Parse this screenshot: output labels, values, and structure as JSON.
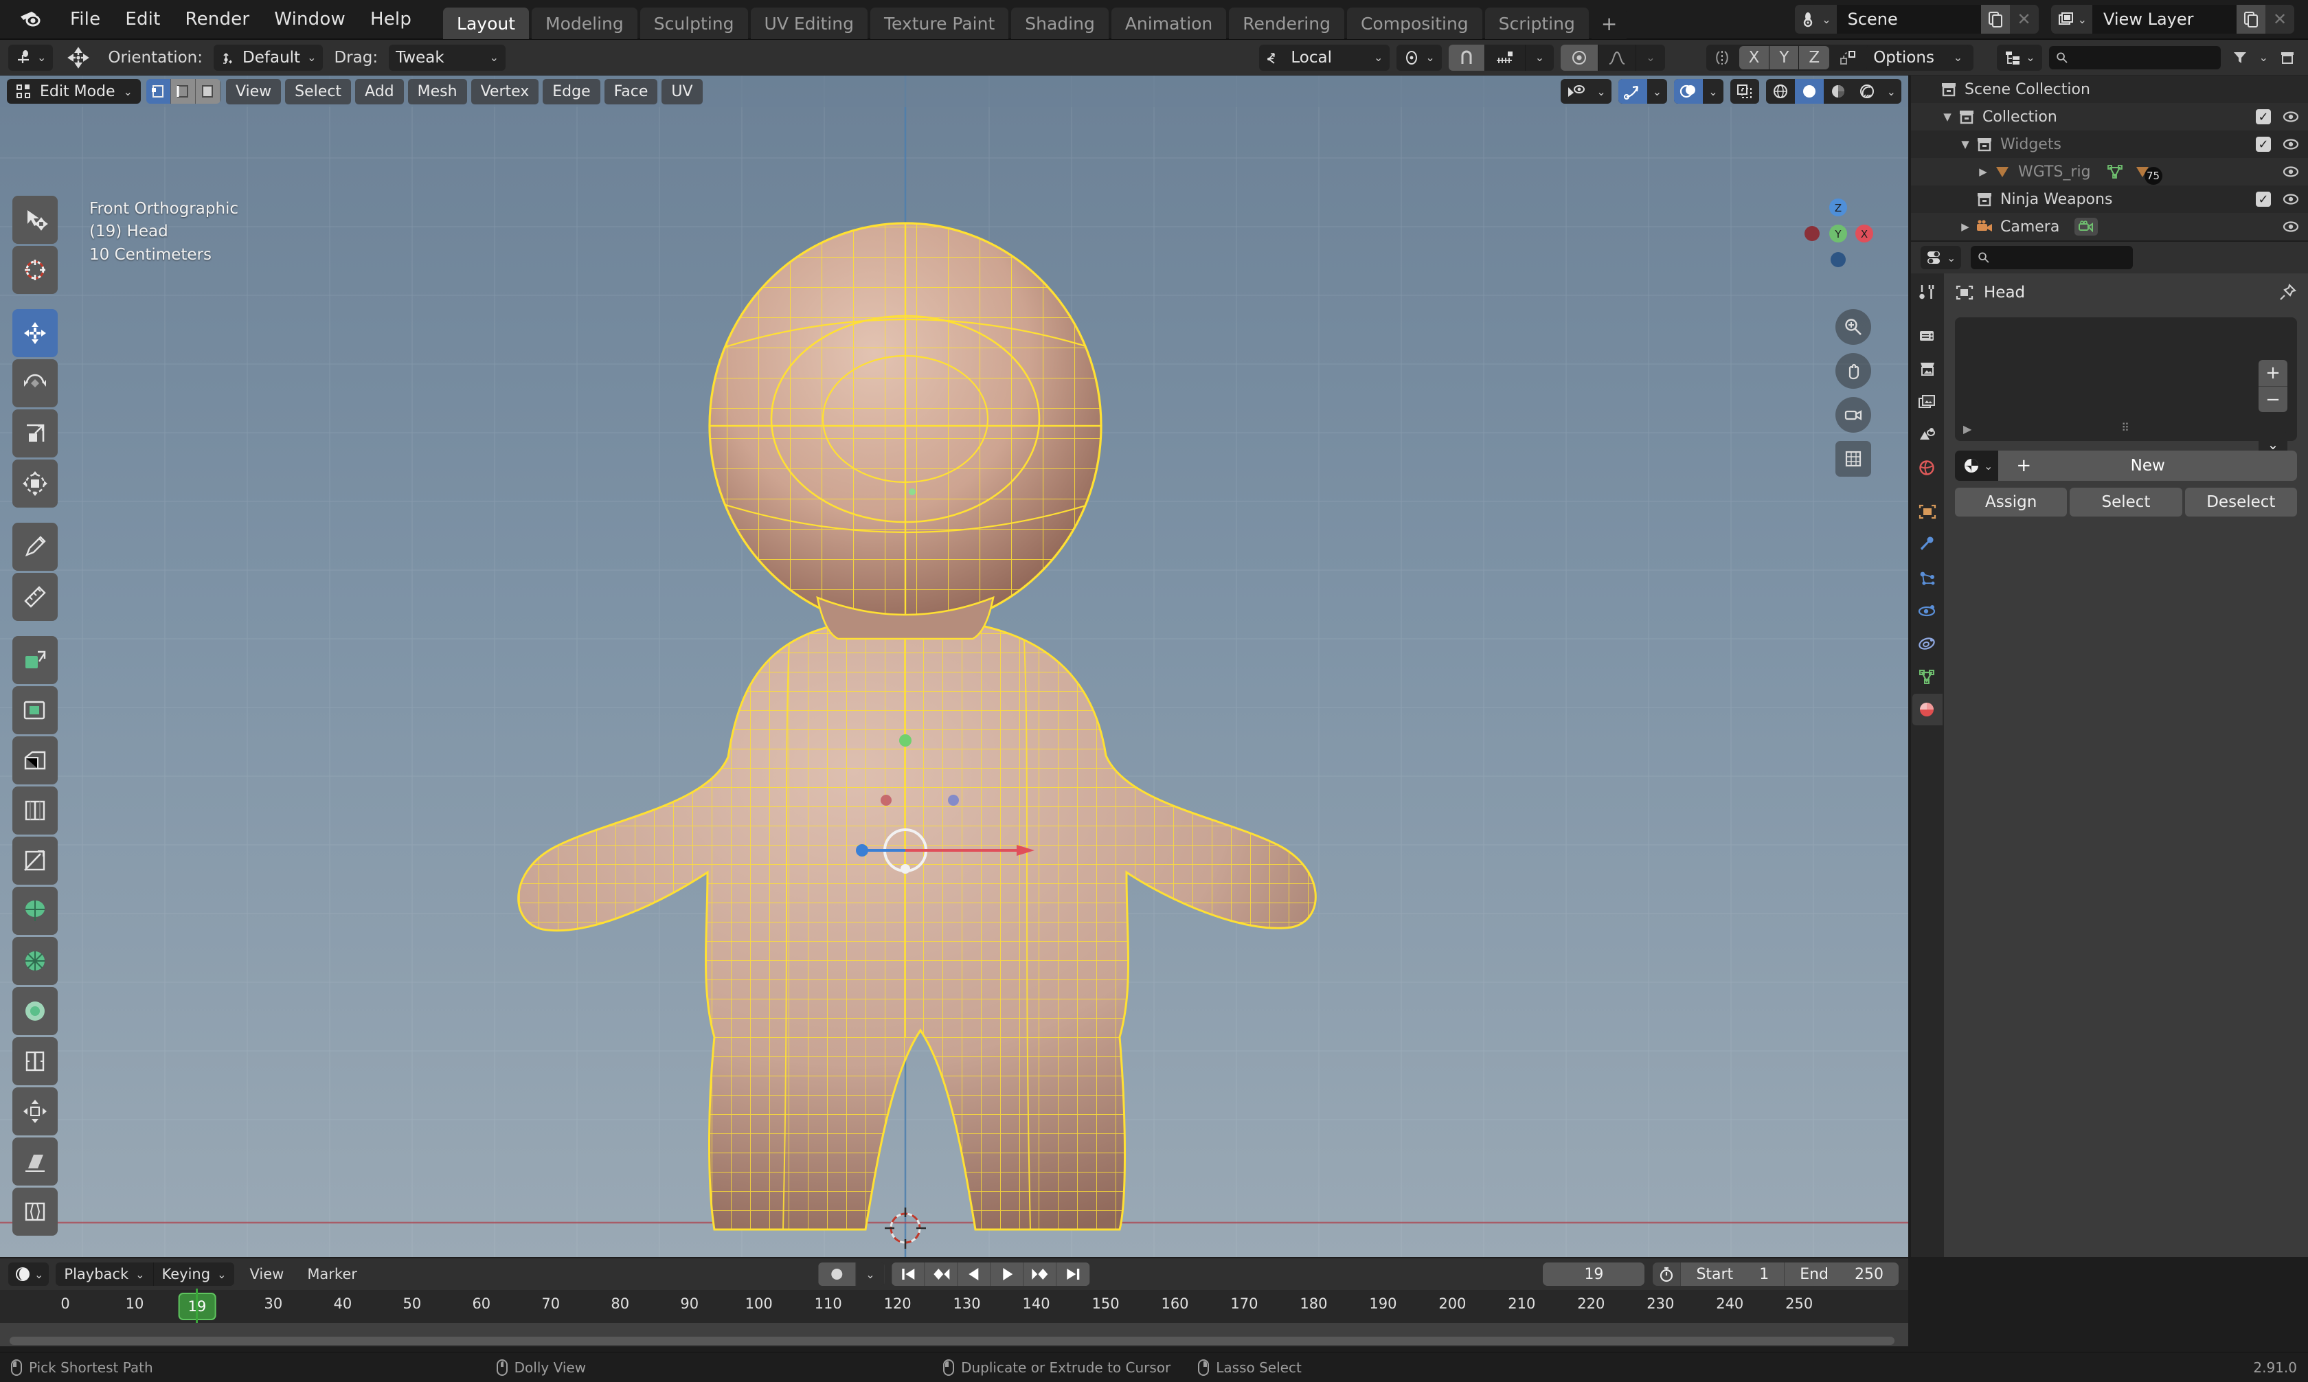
{
  "app": {
    "name": "Blender",
    "version": "2.91.0"
  },
  "topbar": {
    "menus": [
      "File",
      "Edit",
      "Render",
      "Window",
      "Help"
    ],
    "workspaces": [
      {
        "label": "Layout",
        "active": true
      },
      {
        "label": "Modeling",
        "active": false
      },
      {
        "label": "Sculpting",
        "active": false
      },
      {
        "label": "UV Editing",
        "active": false
      },
      {
        "label": "Texture Paint",
        "active": false
      },
      {
        "label": "Shading",
        "active": false
      },
      {
        "label": "Animation",
        "active": false
      },
      {
        "label": "Rendering",
        "active": false
      },
      {
        "label": "Compositing",
        "active": false
      },
      {
        "label": "Scripting",
        "active": false
      }
    ],
    "add_workspace_label": "+",
    "scene": {
      "name": "Scene",
      "new_icon": "copy-icon",
      "unlink_icon": "x-icon"
    },
    "view_layer": {
      "name": "View Layer",
      "new_icon": "copy-icon",
      "unlink_icon": "x-icon"
    }
  },
  "tool_settings": {
    "orientation_label": "Orientation:",
    "orientation_value": "Default",
    "drag_label": "Drag:",
    "drag_value": "Tweak",
    "transform_pivot": "Local",
    "snap_axes": [
      "X",
      "Y",
      "Z"
    ],
    "options_label": "Options"
  },
  "viewport": {
    "mode": "Edit Mode",
    "menus": [
      "View",
      "Select",
      "Add",
      "Mesh",
      "Vertex",
      "Edge",
      "Face",
      "UV"
    ],
    "select_modes": [
      "vertex-select",
      "edge-select",
      "face-select"
    ],
    "active_select_mode": "vertex-select",
    "overlay_text": {
      "view": "Front Orthographic",
      "object": "(19) Head",
      "grid_scale": "10 Centimeters"
    },
    "gizmo_axes": [
      "X",
      "Y",
      "Z"
    ],
    "shading_modes": [
      "wireframe",
      "solid",
      "material-preview",
      "rendered"
    ],
    "active_shading_mode": "solid",
    "nav_buttons": [
      "zoom-icon",
      "pan-hand-icon",
      "camera-view-icon",
      "toggle-ortho-icon"
    ],
    "toolbar_tools": [
      {
        "name": "tweak-select-tool",
        "active": false
      },
      {
        "name": "cursor-tool",
        "active": false
      },
      {
        "name": "move-tool",
        "active": true
      },
      {
        "name": "rotate-tool",
        "active": false
      },
      {
        "name": "scale-tool",
        "active": false
      },
      {
        "name": "transform-tool",
        "active": false
      },
      {
        "name": "annotate-tool",
        "active": false
      },
      {
        "name": "measure-tool",
        "active": false
      },
      {
        "name": "extrude-region-tool",
        "active": false
      },
      {
        "name": "inset-faces-tool",
        "active": false
      },
      {
        "name": "bevel-tool",
        "active": false
      },
      {
        "name": "loop-cut-tool",
        "active": false
      },
      {
        "name": "knife-tool",
        "active": false
      },
      {
        "name": "poly-build-tool",
        "active": false
      },
      {
        "name": "spin-tool",
        "active": false
      },
      {
        "name": "smooth-tool",
        "active": false
      },
      {
        "name": "edge-slide-tool",
        "active": false
      },
      {
        "name": "shrink-fatten-tool",
        "active": false
      },
      {
        "name": "shear-tool",
        "active": false
      },
      {
        "name": "rip-region-tool",
        "active": false
      }
    ]
  },
  "outliner": {
    "search_placeholder": "",
    "rows": [
      {
        "label": "Scene Collection",
        "icon": "collection-icon",
        "indent": 0,
        "expander": "",
        "checkbox": false,
        "eye": false,
        "dim": false
      },
      {
        "label": "Collection",
        "icon": "collection-icon",
        "indent": 1,
        "expander": "▼",
        "checkbox": true,
        "eye": true,
        "dim": false
      },
      {
        "label": "Widgets",
        "icon": "collection-icon",
        "indent": 2,
        "expander": "▼",
        "checkbox": true,
        "eye": true,
        "dim": true
      },
      {
        "label": "WGTS_rig",
        "icon": "armature-icon",
        "indent": 3,
        "expander": "▶",
        "checkbox": false,
        "eye": true,
        "dim": true,
        "badge": "75"
      },
      {
        "label": "Ninja Weapons",
        "icon": "collection-icon",
        "indent": 2,
        "expander": "",
        "checkbox": true,
        "eye": true,
        "dim": false
      },
      {
        "label": "Camera",
        "icon": "camera-icon",
        "indent": 2,
        "expander": "▶",
        "checkbox": false,
        "eye": true,
        "dim": false
      }
    ]
  },
  "properties": {
    "search_placeholder": "",
    "breadcrumb": "Head",
    "tabs": [
      {
        "name": "tool-tab",
        "color": "#d0d0d0",
        "active": false
      },
      {
        "name": "render-tab",
        "color": "#d0d0d0",
        "active": false
      },
      {
        "name": "output-tab",
        "color": "#d0d0d0",
        "active": false
      },
      {
        "name": "view-layer-tab",
        "color": "#d0d0d0",
        "active": false
      },
      {
        "name": "scene-tab",
        "color": "#d0d0d0",
        "active": false
      },
      {
        "name": "world-tab",
        "color": "#e05a5a",
        "active": false
      },
      {
        "name": "object-tab",
        "color": "#d89a5a",
        "active": false
      },
      {
        "name": "modifier-tab",
        "color": "#5a8fd8",
        "active": false
      },
      {
        "name": "particles-tab",
        "color": "#5a8fd8",
        "active": false
      },
      {
        "name": "physics-tab",
        "color": "#5a8fd8",
        "active": false
      },
      {
        "name": "constraints-tab",
        "color": "#5a8fd8",
        "active": false
      },
      {
        "name": "data-tab",
        "color": "#6fbf6f",
        "active": false
      },
      {
        "name": "material-tab",
        "color": "#e04f4f",
        "active": true
      }
    ],
    "slot_list_empty": true,
    "material_new_label": "New",
    "add_slot_label": "+",
    "remove_slot_label": "−",
    "assign_label": "Assign",
    "select_label": "Select",
    "deselect_label": "Deselect"
  },
  "timeline": {
    "menus_grouped": [
      "Playback",
      "Keying"
    ],
    "menus_plain": [
      "View",
      "Marker"
    ],
    "playback_controls": [
      "jump-to-start",
      "jump-to-prev-keyframe",
      "play-reverse",
      "play",
      "jump-to-next-keyframe",
      "jump-to-end"
    ],
    "record_label": "auto-keying",
    "current_frame": "19",
    "start_label": "Start",
    "start_value": "1",
    "end_label": "End",
    "end_value": "250",
    "ruler_ticks": [
      0,
      10,
      19,
      30,
      40,
      50,
      60,
      70,
      80,
      90,
      100,
      110,
      120,
      130,
      140,
      150,
      160,
      170,
      180,
      190,
      200,
      210,
      220,
      230,
      240,
      250
    ],
    "playhead_frame": 19,
    "playhead_color": "#3aa83a"
  },
  "statusbar": {
    "hints": [
      {
        "mouse": "left",
        "label": "Pick Shortest Path"
      },
      {
        "mouse": "mid",
        "label": "Dolly View"
      },
      {
        "mouse": "left",
        "label": "Duplicate or Extrude to Cursor"
      },
      {
        "mouse": "right",
        "label": "Lasso Select"
      }
    ],
    "version": "2.91.0"
  },
  "theme": {
    "accent_blue": "#4772b3",
    "bg_dark": "#1d1d1d",
    "bg_panel": "#303030",
    "bg_editor": "#282828",
    "viewport_top": "#6c8196",
    "viewport_bottom": "#9aa9b5",
    "mesh_wire": "#ffe033",
    "mesh_body": "#c9a795",
    "timeline_green": "#3aa83a"
  }
}
